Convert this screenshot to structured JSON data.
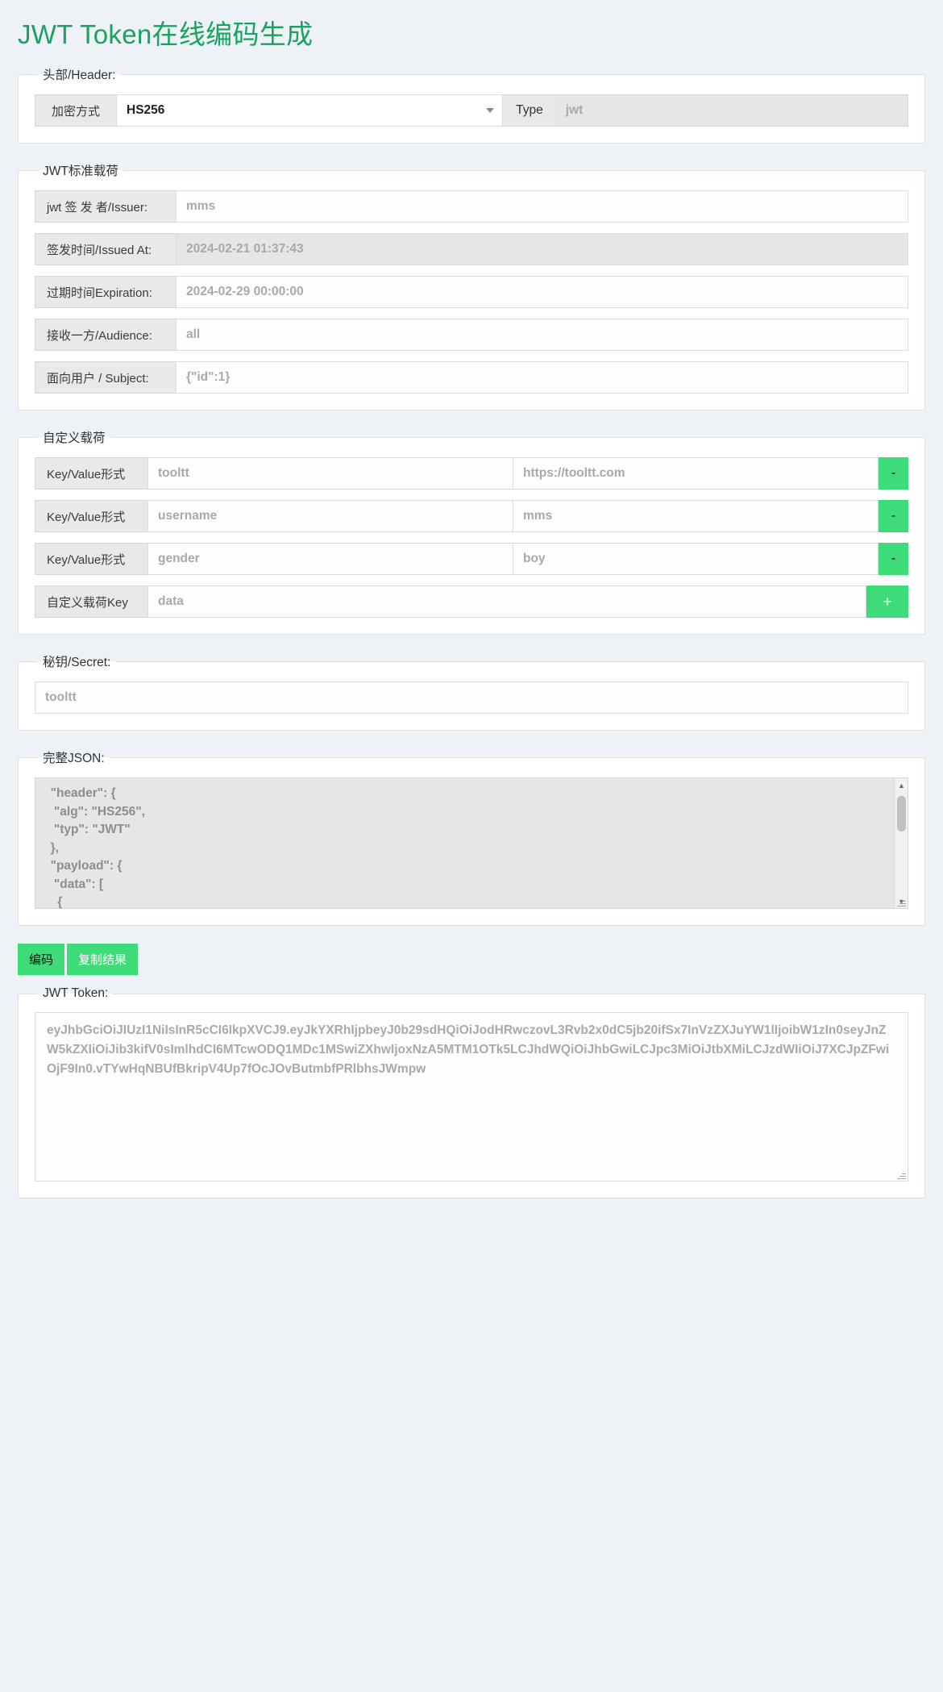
{
  "page": {
    "title": "JWT Token在线编码生成",
    "accent_green": "#1aa260",
    "button_green": "#3ddc79",
    "background": "#eef2f7"
  },
  "header_section": {
    "legend": "头部/Header:",
    "alg_label": "加密方式",
    "alg_value": "HS256",
    "alg_options": [
      "HS256"
    ],
    "type_label": "Type",
    "type_value": "jwt"
  },
  "standard_payload": {
    "legend": "JWT标准载荷",
    "rows": [
      {
        "label": "jwt 签 发 者/Issuer:",
        "value": "mms",
        "readonly": false
      },
      {
        "label": "签发时间/Issued At:",
        "value": "2024-02-21 01:37:43",
        "readonly": true
      },
      {
        "label": "过期时间Expiration:",
        "value": "2024-02-29 00:00:00",
        "readonly": false
      },
      {
        "label": "接收一方/Audience:",
        "value": "all",
        "readonly": false
      },
      {
        "label": "面向用户 / Subject:",
        "value": "{\"id\":1}",
        "readonly": false
      }
    ]
  },
  "custom_payload": {
    "legend": "自定义载荷",
    "kv_label": "Key/Value形式",
    "rows": [
      {
        "key": "tooltt",
        "value": "https://tooltt.com",
        "button": "-"
      },
      {
        "key": "username",
        "value": "mms",
        "button": "-"
      },
      {
        "key": "gender",
        "value": "boy",
        "button": "-"
      }
    ],
    "add_row": {
      "label": "自定义载荷Key",
      "value": "data",
      "button": "+"
    }
  },
  "secret_section": {
    "legend": "秘钥/Secret:",
    "value": "tooltt"
  },
  "json_section": {
    "legend": "完整JSON:",
    "content": "  \"header\": {\n   \"alg\": \"HS256\",\n   \"typ\": \"JWT\"\n  },\n  \"payload\": {\n   \"data\": [\n    {"
  },
  "actions": {
    "encode_label": "编码",
    "copy_label": "复制结果"
  },
  "token_section": {
    "legend": "JWT Token:",
    "value": "eyJhbGciOiJIUzI1NiIsInR5cCI6IkpXVCJ9.eyJkYXRhIjpbeyJ0b29sdHQiOiJodHRwczovL3Rvb2x0dC5jb20ifSx7InVzZXJuYW1lIjoibW1zIn0seyJnZW5kZXIiOiJib3kifV0sImlhdCI6MTcwODQ1MDc1MSwiZXhwIjoxNzA5MTM1OTk5LCJhdWQiOiJhbGwiLCJpc3MiOiJtbXMiLCJzdWIiOiJ7XCJpZFwiOjF9In0.vTYwHqNBUfBkripV4Up7fOcJOvButmbfPRlbhsJWmpw"
  }
}
